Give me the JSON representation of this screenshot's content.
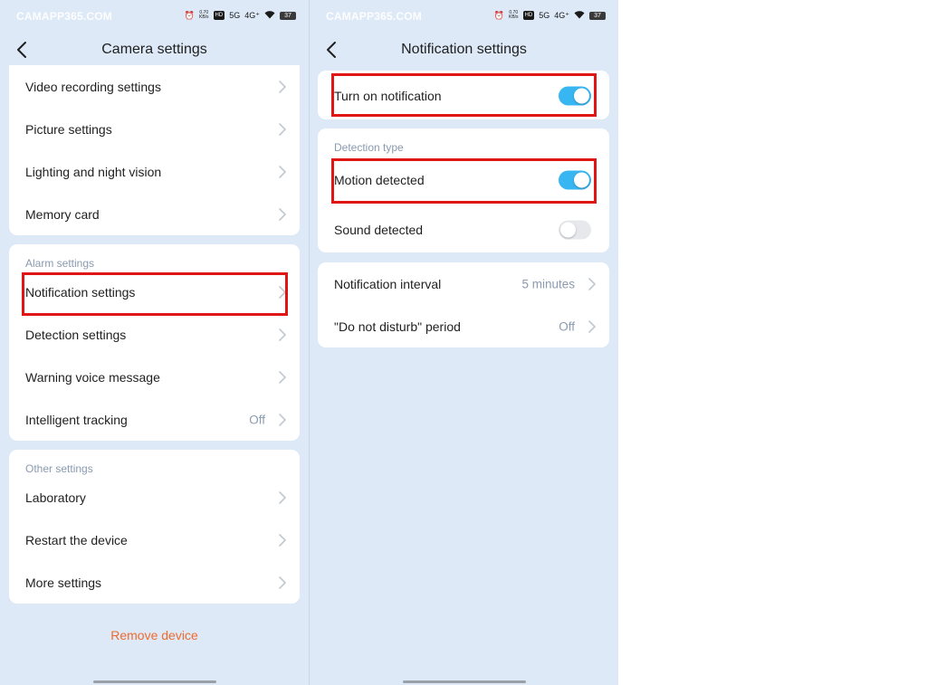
{
  "left": {
    "status": {
      "watermark": "CAMAPP365.COM",
      "speed_value": "0.70",
      "speed_unit": "KB/s",
      "hd_badge": "HD",
      "net_a": "5G",
      "net_b": "4G⁺",
      "battery": "37"
    },
    "title": "Camera settings",
    "general_items": [
      {
        "label": "Video recording settings"
      },
      {
        "label": "Picture settings"
      },
      {
        "label": "Lighting and night vision"
      },
      {
        "label": "Memory card"
      }
    ],
    "alarm_section": {
      "label": "Alarm settings",
      "items": [
        {
          "label": "Notification settings"
        },
        {
          "label": "Detection settings"
        },
        {
          "label": "Warning voice message"
        },
        {
          "label": "Intelligent tracking",
          "value": "Off"
        }
      ]
    },
    "other_section": {
      "label": "Other settings",
      "items": [
        {
          "label": "Laboratory"
        },
        {
          "label": "Restart the device"
        },
        {
          "label": "More settings"
        }
      ]
    },
    "remove_label": "Remove device"
  },
  "right": {
    "status": {
      "watermark": "CAMAPP365.COM",
      "speed_value": "0.70",
      "speed_unit": "KB/s",
      "hd_badge": "HD",
      "net_a": "5G",
      "net_b": "4G⁺",
      "battery": "37"
    },
    "title": "Notification settings",
    "notification": {
      "label": "Turn on notification",
      "enabled": true
    },
    "detection_section": {
      "label": "Detection type",
      "items": [
        {
          "label": "Motion detected",
          "enabled": true
        },
        {
          "label": "Sound detected",
          "enabled": false
        }
      ]
    },
    "interval_items": [
      {
        "label": "Notification interval",
        "value": "5 minutes"
      },
      {
        "label": "\"Do not disturb\" period",
        "value": "Off"
      }
    ]
  },
  "colors": {
    "background": "#dde9f7",
    "card": "#ffffff",
    "accent_toggle": "#38b6f2",
    "highlight_frame": "#e01515",
    "remove_text": "#f06a2e",
    "muted_text": "#8b9bb0"
  }
}
